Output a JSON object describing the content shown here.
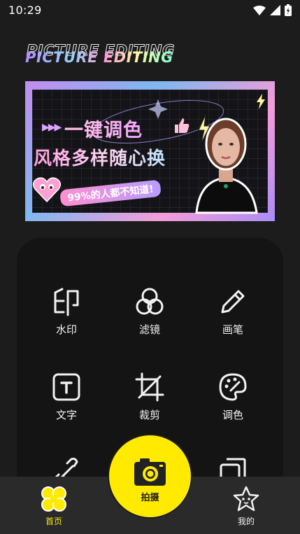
{
  "status_bar": {
    "time": "10:29"
  },
  "header": {
    "logo_text": "PICTURE EDITING"
  },
  "banner": {
    "line1": "一键调色",
    "line2": "风格多样随心换",
    "line3": "99%的人都不知道!"
  },
  "tools": [
    {
      "label": "水印",
      "icon": "stamp-icon"
    },
    {
      "label": "滤镜",
      "icon": "filter-circles-icon"
    },
    {
      "label": "画笔",
      "icon": "pencil-icon"
    },
    {
      "label": "文字",
      "icon": "text-box-icon"
    },
    {
      "label": "裁剪",
      "icon": "crop-icon"
    },
    {
      "label": "调色",
      "icon": "palette-icon"
    },
    {
      "label": "",
      "icon": "link-icon"
    },
    {
      "label": "",
      "icon": "layers-icon"
    }
  ],
  "bottom_nav": {
    "home_label": "首页",
    "capture_label": "拍摄",
    "mine_label": "我的"
  },
  "colors": {
    "accent": "#ffea00",
    "background": "#1c1c1c",
    "card": "#141414",
    "nav": "#2a2a2a"
  }
}
